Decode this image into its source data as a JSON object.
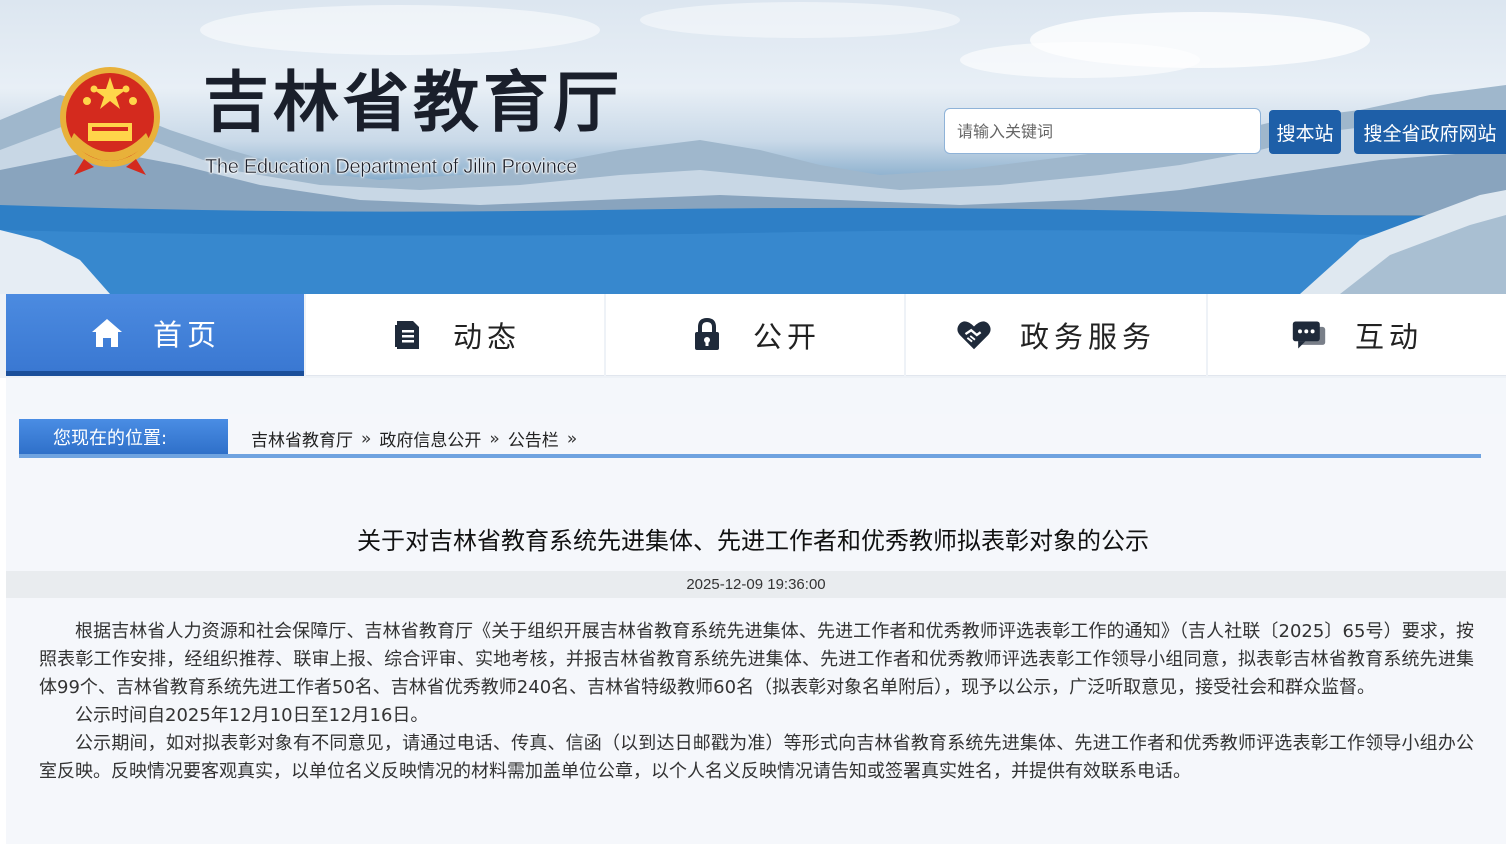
{
  "header": {
    "title": "吉林省教育厅",
    "subtitle": "The Education Department of Jilin Province",
    "search": {
      "placeholder": "请输入关键词",
      "value": "",
      "btn_site": "搜本站",
      "btn_province": "搜全省政府网站"
    }
  },
  "nav": {
    "items": [
      {
        "label": "首页",
        "icon": "home-icon",
        "active": true
      },
      {
        "label": "动态",
        "icon": "document-icon",
        "active": false
      },
      {
        "label": "公开",
        "icon": "lock-icon",
        "active": false
      },
      {
        "label": "政务服务",
        "icon": "heart-handshake-icon",
        "active": false
      },
      {
        "label": "互动",
        "icon": "chat-icon",
        "active": false
      }
    ]
  },
  "breadcrumb": {
    "label": "您现在的位置:",
    "items": [
      "吉林省教育厅",
      "政府信息公开",
      "公告栏"
    ],
    "separator": "»"
  },
  "article": {
    "title": "关于对吉林省教育系统先进集体、先进工作者和优秀教师拟表彰对象的公示",
    "date": "2025-12-09 19:36:00",
    "paragraphs": [
      "根据吉林省人力资源和社会保障厅、吉林省教育厅《关于组织开展吉林省教育系统先进集体、先进工作者和优秀教师评选表彰工作的通知》（吉人社联〔2025〕65号）要求，按照表彰工作安排，经组织推荐、联审上报、综合评审、实地考核，并报吉林省教育系统先进集体、先进工作者和优秀教师评选表彰工作领导小组同意，拟表彰吉林省教育系统先进集体99个、吉林省教育系统先进工作者50名、吉林省优秀教师240名、吉林省特级教师60名（拟表彰对象名单附后），现予以公示，广泛听取意见，接受社会和群众监督。",
      "公示时间自2025年12月10日至12月16日。",
      "公示期间，如对拟表彰对象有不同意见，请通过电话、传真、信函（以到达日邮戳为准）等形式向吉林省教育系统先进集体、先进工作者和优秀教师评选表彰工作领导小组办公室反映。反映情况要客观真实，以单位名义反映情况的材料需加盖单位公章，以个人名义反映情况请告知或签署真实姓名，并提供有效联系电话。"
    ]
  },
  "colors": {
    "nav_active": "#3a78d2",
    "search_button": "#1e5fa8",
    "breadcrumb_label": "#2f70c9"
  }
}
